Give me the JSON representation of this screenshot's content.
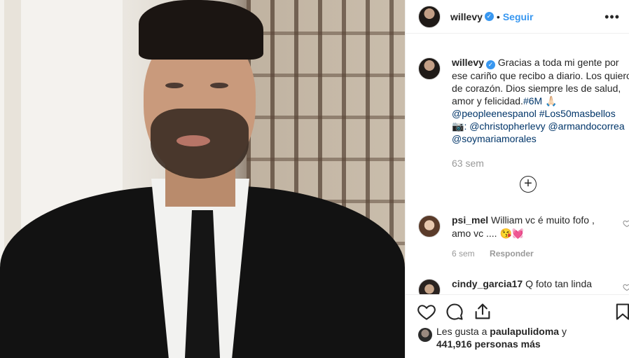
{
  "post": {
    "username": "willevy",
    "follow_label": "Seguir",
    "more_label": "•••",
    "caption_lines": [
      "Gracias a toda mi gente por",
      "ese cariño que recibo a diario. Los",
      "quiero de corazón. Dios siempre les de",
      "salud, amor y felicidad."
    ],
    "caption_tag1": "#6M",
    "caption_emoji": "🙏🏻",
    "caption_tags_line": "@peopleenespanol #Los50masbellos",
    "camera_emoji": "📷",
    "caption_credit": ": @christopherlevy @armandocorrea",
    "caption_credit2": "@soymariamorales",
    "time_ago": "63 sem",
    "load_more": "+"
  },
  "comments": [
    {
      "username": "psi_mel",
      "text_line1": "William vc é muito fofo ,",
      "text_line2": "amo vc .... 😘💓",
      "time": "6 sem",
      "reply_label": "Responder"
    },
    {
      "username": "cindy_garcia17",
      "text_line1": "Q foto tan linda"
    }
  ],
  "likes": {
    "prefix": "Les gusta a ",
    "liker": "paulapulidoma",
    "connector": " y",
    "count_text": "441,916 personas más"
  },
  "colors": {
    "link": "#3897f0",
    "tag": "#003569",
    "muted": "#999999"
  },
  "icons": [
    "heart-icon",
    "comment-icon",
    "share-icon",
    "bookmark-icon",
    "verified-icon",
    "more-icon",
    "plus-circle-icon"
  ]
}
